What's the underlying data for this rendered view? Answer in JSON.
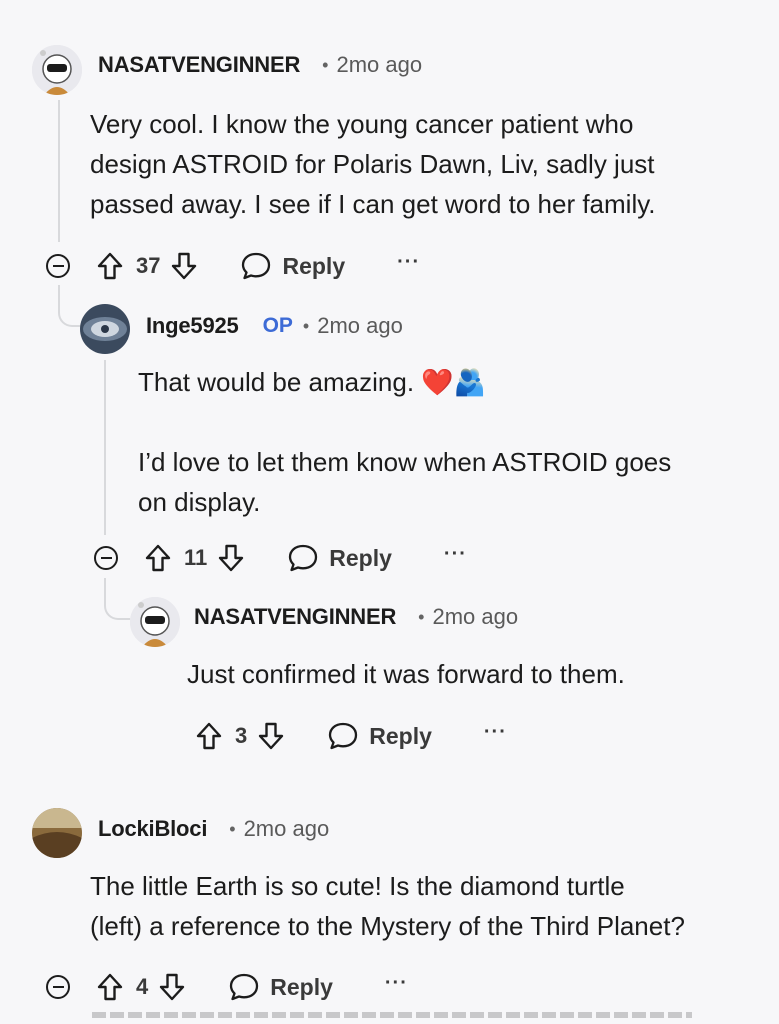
{
  "comments": [
    {
      "username": "NASATVENGINNER",
      "time": "2mo ago",
      "body": "Very cool. I know the young cancer patient who\ndesign ASTROID for Polaris Dawn, Liv, sadly just\npassed away. I see if I can get word to her family.",
      "votes": "37",
      "reply_label": "Reply",
      "more_label": "···"
    },
    {
      "username": "Inge5925",
      "op_badge": "OP",
      "time": "2mo ago",
      "body": "That would be amazing. ❤️🫂\n\nI’d love to let them know when ASTROID goes\non display.",
      "votes": "11",
      "reply_label": "Reply",
      "more_label": "···"
    },
    {
      "username": "NASATVENGINNER",
      "time": "2mo ago",
      "body": "Just confirmed it was forward to them.",
      "votes": "3",
      "reply_label": "Reply",
      "more_label": "···"
    },
    {
      "username": "LockiBloci",
      "time": "2mo ago",
      "body": "The little Earth is so cute! Is the diamond turtle\n(left) a reference to the Mystery of the Third Planet?",
      "votes": "4",
      "reply_label": "Reply",
      "more_label": "···"
    }
  ],
  "dot": "•",
  "colors": {
    "op": "#3d6bd6",
    "thread_line": "#d8d9dc",
    "background": "#f7f7f9"
  }
}
